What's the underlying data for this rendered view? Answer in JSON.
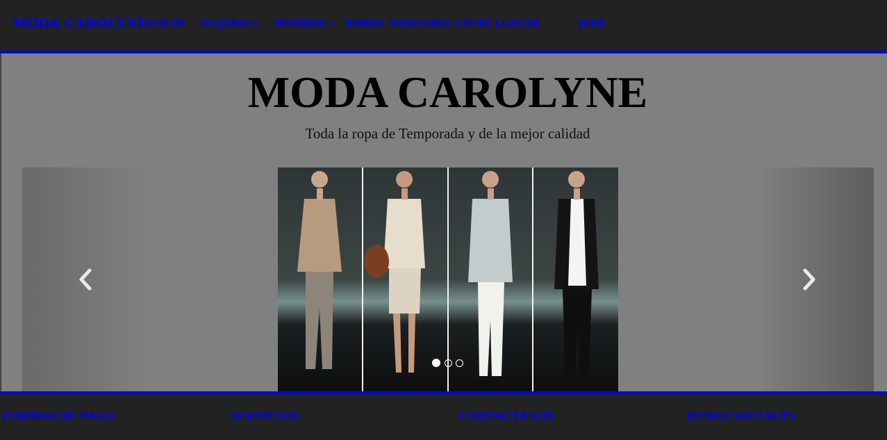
{
  "navbar": {
    "brand": "MODA CAROLYNE",
    "items": [
      {
        "label": "INICIO",
        "dropdown": false
      },
      {
        "label": "MUJERES",
        "dropdown": true
      },
      {
        "label": "HOMBRE",
        "dropdown": true
      },
      {
        "label": "SOBRE NOSOTROS",
        "dropdown": false
      },
      {
        "label": "COMO LLEGAR",
        "dropdown": false
      },
      {
        "label": "JOSE",
        "dropdown": false
      }
    ]
  },
  "hero": {
    "title": "MODA CAROLYNE",
    "subtitle": "Toda la ropa de Temporada y de la mejor calidad"
  },
  "carousel": {
    "prev_icon": "chevron-left-icon",
    "next_icon": "chevron-right-icon",
    "indicator_count": 3,
    "active_index": 0
  },
  "footer": {
    "headings": [
      "FORMAS DE PAGO",
      "SERVICIOS",
      "CONTACTANOS",
      "REDES SOCIALES"
    ]
  },
  "colors": {
    "link": "#0000ff",
    "navbar_bg": "#222222",
    "page_bg": "#808080",
    "accent_rule": "#0000ee"
  }
}
